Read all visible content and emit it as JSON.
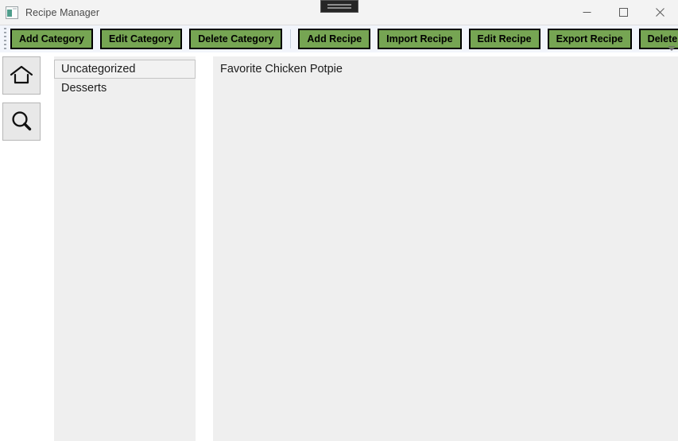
{
  "window": {
    "title": "Recipe Manager",
    "app_icon": "window-app-icon",
    "controls": {
      "minimize": "minimize-icon",
      "maximize": "maximize-icon",
      "close": "close-icon"
    }
  },
  "overlay": {
    "notch": "screen-recording-indicator"
  },
  "toolbar": {
    "grip": "drag-handle",
    "accent_color": "#76a553",
    "border_color": "#000000",
    "background": "#f2f5fb",
    "category_buttons": [
      {
        "label": "Add Category",
        "name": "add-category-button"
      },
      {
        "label": "Edit Category",
        "name": "edit-category-button"
      },
      {
        "label": "Delete Category",
        "name": "delete-category-button"
      }
    ],
    "recipe_buttons": [
      {
        "label": "Add Recipe",
        "name": "add-recipe-button"
      },
      {
        "label": "Import Recipe",
        "name": "import-recipe-button"
      },
      {
        "label": "Edit Recipe",
        "name": "edit-recipe-button"
      },
      {
        "label": "Export Recipe",
        "name": "export-recipe-button"
      },
      {
        "label": "Delete Recipe",
        "name": "delete-recipe-button"
      }
    ],
    "overflow": "toolbar-overflow-chevron"
  },
  "rail": {
    "buttons": [
      {
        "icon": "home-icon",
        "name": "home-button"
      },
      {
        "icon": "search-icon",
        "name": "search-button"
      }
    ]
  },
  "categories": {
    "items": [
      {
        "label": "Uncategorized",
        "selected": true
      },
      {
        "label": "Desserts",
        "selected": false
      }
    ]
  },
  "recipes": {
    "items": [
      {
        "label": "Favorite Chicken Potpie",
        "selected": false
      }
    ]
  }
}
